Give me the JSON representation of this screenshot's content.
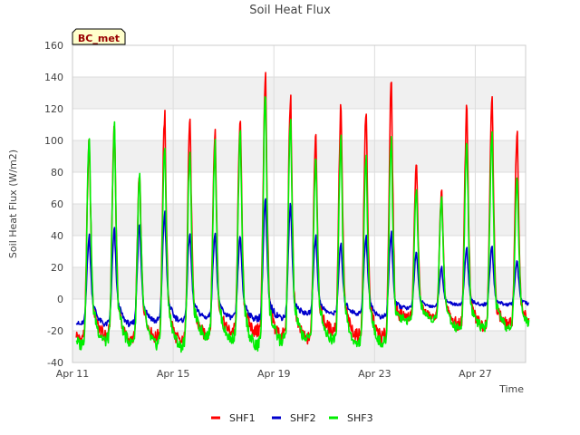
{
  "chart_data": {
    "type": "line",
    "title": "Soil Heat Flux",
    "xlabel": "Time",
    "ylabel": "Soil Heat Flux (W/m2)",
    "site_label": "BC_met",
    "ylim": [
      -40,
      160
    ],
    "yticks": [
      -40,
      -20,
      0,
      20,
      40,
      60,
      80,
      100,
      120,
      140,
      160
    ],
    "xlim": [
      "2024-04-11",
      "2024-04-29"
    ],
    "xticks": [
      {
        "date": "2024-04-11",
        "label": "Apr 11"
      },
      {
        "date": "2024-04-15",
        "label": "Apr 15"
      },
      {
        "date": "2024-04-19",
        "label": "Apr 19"
      },
      {
        "date": "2024-04-23",
        "label": "Apr 23"
      },
      {
        "date": "2024-04-27",
        "label": "Apr 27"
      }
    ],
    "grid": true,
    "legend_position": "bottom",
    "days": [
      "Apr 11",
      "Apr 12",
      "Apr 13",
      "Apr 14",
      "Apr 15",
      "Apr 16",
      "Apr 17",
      "Apr 18",
      "Apr 19",
      "Apr 20",
      "Apr 21",
      "Apr 22",
      "Apr 23",
      "Apr 24",
      "Apr 25",
      "Apr 26",
      "Apr 27",
      "Apr 28"
    ],
    "series": [
      {
        "name": "SHF1",
        "color": "#ff0000",
        "daily_max": [
          100,
          112,
          80,
          116,
          115,
          106,
          116,
          142,
          127,
          106,
          122,
          120,
          136,
          86,
          68,
          122,
          130,
          104
        ],
        "daily_min": [
          -22,
          -20,
          -23,
          -21,
          -24,
          -20,
          -18,
          -18,
          -20,
          -22,
          -17,
          -20,
          -21,
          -10,
          -10,
          -14,
          -14,
          -14
        ]
      },
      {
        "name": "SHF2",
        "color": "#0000cc",
        "daily_max": [
          40,
          44,
          47,
          55,
          42,
          42,
          40,
          63,
          60,
          40,
          35,
          40,
          42,
          30,
          20,
          32,
          33,
          24
        ],
        "daily_min": [
          -14,
          -14,
          -14,
          -12,
          -12,
          -10,
          -10,
          -11,
          -10,
          -8,
          -8,
          -8,
          -10,
          -5,
          -4,
          -3,
          -3,
          -3
        ]
      },
      {
        "name": "SHF3",
        "color": "#00ee00",
        "daily_max": [
          105,
          110,
          79,
          98,
          95,
          98,
          105,
          130,
          114,
          89,
          101,
          90,
          102,
          70,
          65,
          100,
          104,
          77
        ],
        "daily_min": [
          -25,
          -23,
          -24,
          -25,
          -26,
          -20,
          -22,
          -26,
          -23,
          -22,
          -22,
          -25,
          -25,
          -12,
          -11,
          -16,
          -16,
          -16
        ]
      }
    ]
  }
}
